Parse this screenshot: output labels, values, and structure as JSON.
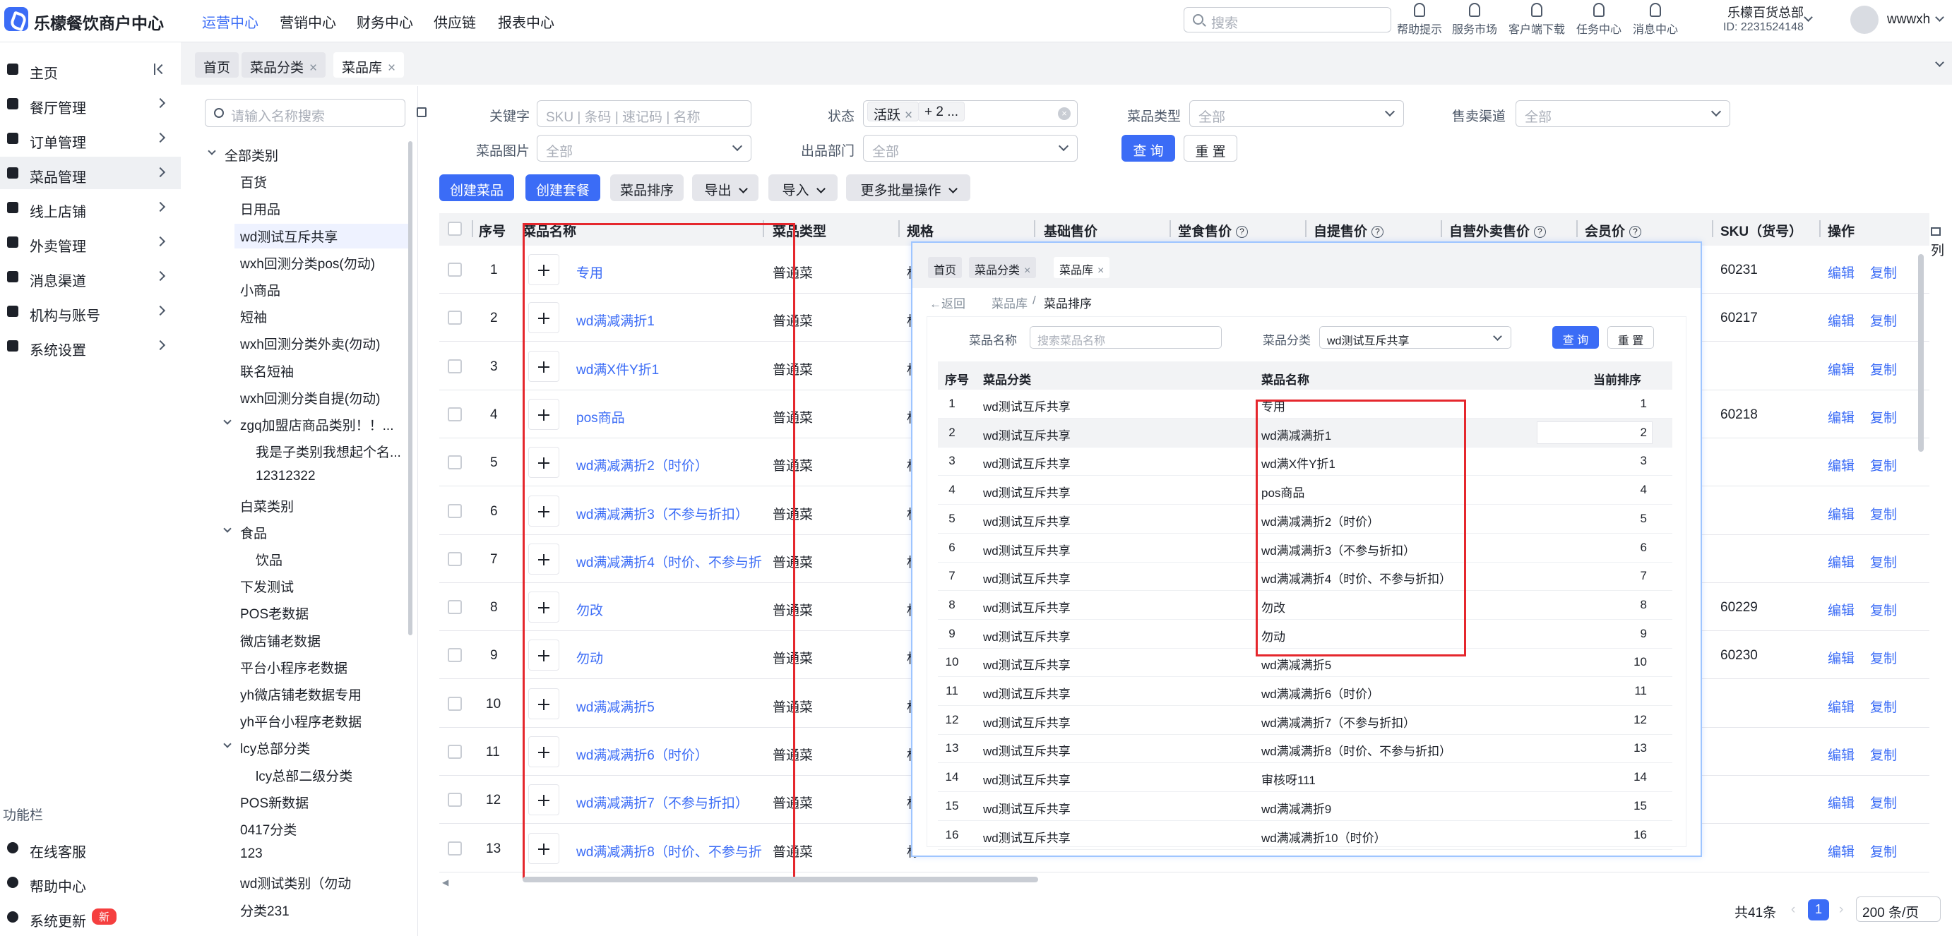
{
  "app": {
    "title": "乐檬餐饮商户中心"
  },
  "topnav": [
    "运营中心",
    "营销中心",
    "财务中心",
    "供应链",
    "报表中心"
  ],
  "search": {
    "placeholder": "搜索"
  },
  "tools": [
    "帮助提示",
    "服务市场",
    "客户端下载",
    "任务中心",
    "消息中心"
  ],
  "org": {
    "name": "乐檬百货总部",
    "id": "ID: 2231524148"
  },
  "user": {
    "name": "wwwxh"
  },
  "sidebar": {
    "items": [
      "主页",
      "餐厅管理",
      "订单管理",
      "菜品管理",
      "线上店铺",
      "外卖管理",
      "消息渠道",
      "机构与账号",
      "系统设置"
    ],
    "section": "功能栏",
    "bottom": [
      "在线客服",
      "帮助中心",
      "系统更新"
    ],
    "badge": "新"
  },
  "tabs": [
    "首页",
    "菜品分类",
    "菜品库"
  ],
  "tree": {
    "placeholder": "请输入名称搜索",
    "nodes": [
      "全部类别",
      "百货",
      "日用品",
      "wd测试互斥共享",
      "wxh回测分类pos(勿动)",
      "小商品",
      "短袖",
      "wxh回测分类外卖(勿动)",
      "联名短袖",
      "wxh回测分类自提(勿动)",
      "zgq加盟店商品类别！！...",
      "我是子类别我想起个名...",
      "12312322",
      "白菜类别",
      "食品",
      "饮品",
      "下发测试",
      "POS老数据",
      "微店铺老数据",
      "平台小程序老数据",
      "yh微店铺老数据专用",
      "yh平台小程序老数据",
      "lcy总部分类",
      "lcy总部二级分类",
      "POS新数据",
      "0417分类",
      "123",
      "wd测试类别（勿动",
      "分类231"
    ]
  },
  "filters": {
    "keyword_label": "关键字",
    "keyword_placeholder": "SKU | 条码 | 速记码 | 名称",
    "status_label": "状态",
    "status_tag1": "活跃",
    "status_tag2": "+ 2 ...",
    "type_label": "菜品类型",
    "type_value": "全部",
    "channel_label": "售卖渠道",
    "channel_value": "全部",
    "image_label": "菜品图片",
    "image_value": "全部",
    "dept_label": "出品部门",
    "dept_value": "全部",
    "query": "查 询",
    "reset": "重 置"
  },
  "actions": {
    "create_dish": "创建菜品",
    "create_set": "创建套餐",
    "sort": "菜品排序",
    "export": "导出",
    "import": "导入",
    "batch": "更多批量操作"
  },
  "table": {
    "headers": [
      "序号",
      "菜品名称",
      "菜品类型",
      "规格",
      "基础售价",
      "堂食售价",
      "自提售价",
      "自营外卖售价",
      "会员价",
      "SKU（货号）",
      "操作"
    ],
    "col_setting": "列",
    "edit": "编辑",
    "copy": "复制",
    "rows": [
      {
        "no": "1",
        "name": "专用",
        "type": "普通菜",
        "spec": "标",
        "sku": "60231"
      },
      {
        "no": "2",
        "name": "wd满减满折1",
        "type": "普通菜",
        "spec": "标",
        "sku": "60217"
      },
      {
        "no": "3",
        "name": "wd满X件Y折1",
        "type": "普通菜",
        "spec": "标",
        "sku": ""
      },
      {
        "no": "4",
        "name": "pos商品",
        "type": "普通菜",
        "spec": "标",
        "sku": "60218"
      },
      {
        "no": "5",
        "name": "wd满减满折2（时价）",
        "type": "普通菜",
        "spec": "标",
        "sku": ""
      },
      {
        "no": "6",
        "name": "wd满减满折3（不参与折扣）",
        "type": "普通菜",
        "spec": "标",
        "sku": ""
      },
      {
        "no": "7",
        "name": "wd满减满折4（时价、不参与折",
        "type": "普通菜",
        "spec": "标",
        "sku": ""
      },
      {
        "no": "8",
        "name": "勿改",
        "type": "普通菜",
        "spec": "标",
        "sku": "60229"
      },
      {
        "no": "9",
        "name": "勿动",
        "type": "普通菜",
        "spec": "标",
        "sku": "60230"
      },
      {
        "no": "10",
        "name": "wd满减满折5",
        "type": "普通菜",
        "spec": "标",
        "sku": ""
      },
      {
        "no": "11",
        "name": "wd满减满折6（时价）",
        "type": "普通菜",
        "spec": "标",
        "sku": ""
      },
      {
        "no": "12",
        "name": "wd满减满折7（不参与折扣）",
        "type": "普通菜",
        "spec": "标",
        "sku": ""
      },
      {
        "no": "13",
        "name": "wd满减满折8（时价、不参与折",
        "type": "普通菜",
        "spec": "标",
        "sku": ""
      }
    ]
  },
  "pagination": {
    "total": "共41条",
    "page": "1",
    "size": "200 条/页"
  },
  "overlay": {
    "tabs": [
      "首页",
      "菜品分类",
      "菜品库"
    ],
    "back": "返回",
    "breadcrumb1": "菜品库",
    "breadcrumb_sep": "/",
    "breadcrumb2": "菜品排序",
    "name_label": "菜品名称",
    "name_placeholder": "搜索菜品名称",
    "cat_label": "菜品分类",
    "cat_value": "wd测试互斥共享",
    "query": "查 询",
    "reset": "重 置",
    "headers": [
      "序号",
      "菜品分类",
      "菜品名称",
      "当前排序"
    ],
    "rows": [
      {
        "no": "1",
        "cat": "wd测试互斥共享",
        "name": "专用",
        "order": "1"
      },
      {
        "no": "2",
        "cat": "wd测试互斥共享",
        "name": "wd满减满折1",
        "order": "2"
      },
      {
        "no": "3",
        "cat": "wd测试互斥共享",
        "name": "wd满X件Y折1",
        "order": "3"
      },
      {
        "no": "4",
        "cat": "wd测试互斥共享",
        "name": "pos商品",
        "order": "4"
      },
      {
        "no": "5",
        "cat": "wd测试互斥共享",
        "name": "wd满减满折2（时价）",
        "order": "5"
      },
      {
        "no": "6",
        "cat": "wd测试互斥共享",
        "name": "wd满减满折3（不参与折扣）",
        "order": "6"
      },
      {
        "no": "7",
        "cat": "wd测试互斥共享",
        "name": "wd满减满折4（时价、不参与折扣）",
        "order": "7"
      },
      {
        "no": "8",
        "cat": "wd测试互斥共享",
        "name": "勿改",
        "order": "8"
      },
      {
        "no": "9",
        "cat": "wd测试互斥共享",
        "name": "勿动",
        "order": "9"
      },
      {
        "no": "10",
        "cat": "wd测试互斥共享",
        "name": "wd满减满折5",
        "order": "10"
      },
      {
        "no": "11",
        "cat": "wd测试互斥共享",
        "name": "wd满减满折6（时价）",
        "order": "11"
      },
      {
        "no": "12",
        "cat": "wd测试互斥共享",
        "name": "wd满减满折7（不参与折扣）",
        "order": "12"
      },
      {
        "no": "13",
        "cat": "wd测试互斥共享",
        "name": "wd满减满折8（时价、不参与折扣）",
        "order": "13"
      },
      {
        "no": "14",
        "cat": "wd测试互斥共享",
        "name": "审核呀111",
        "order": "14"
      },
      {
        "no": "15",
        "cat": "wd测试互斥共享",
        "name": "wd满减满折9",
        "order": "15"
      },
      {
        "no": "16",
        "cat": "wd测试互斥共享",
        "name": "wd满减满折10（时价）",
        "order": "16"
      }
    ]
  },
  "colors": {
    "primary": "#3b6cf6",
    "highlight": "#e5272d",
    "badge": "#f53f3f"
  }
}
